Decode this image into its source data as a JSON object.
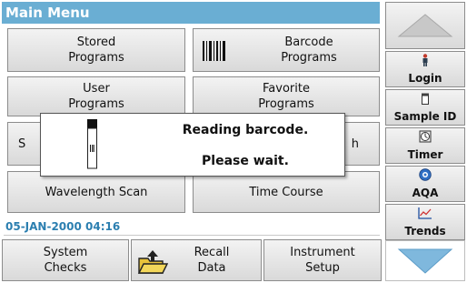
{
  "title": "Main Menu",
  "menu": {
    "stored_programs": "Stored\nPrograms",
    "barcode_programs": "Barcode\nPrograms",
    "user_programs": "User\nPrograms",
    "favorite_programs": "Favorite\nPrograms",
    "single_wavelength_partial": "S",
    "multi_wavelength_partial": "h",
    "wavelength_scan": "Wavelength Scan",
    "time_course": "Time Course"
  },
  "status": {
    "datetime": "05-JAN-2000  04:16"
  },
  "bottom": {
    "system_checks": "System\nChecks",
    "recall_data": "Recall\nData",
    "instrument_setup": "Instrument\nSetup"
  },
  "side": {
    "login": "Login",
    "sample_id": "Sample ID",
    "timer": "Timer",
    "aqa": "AQA",
    "trends": "Trends"
  },
  "dialog": {
    "line1": "Reading barcode.",
    "line2": "Please wait."
  },
  "icons": {
    "barcode": "barcode-icon",
    "folder": "folder-upload-icon",
    "login": "person-icon",
    "sample_id": "vial-icon",
    "timer": "timer-icon",
    "aqa": "aqa-icon",
    "trends": "trend-chart-icon",
    "scroll_up": "triangle-up-icon",
    "scroll_down": "triangle-down-icon",
    "vial": "sample-cell-icon"
  },
  "colors": {
    "title_bar": "#6aaed3",
    "date_text": "#2c7fb0",
    "arrow": "#7fb8dd"
  }
}
